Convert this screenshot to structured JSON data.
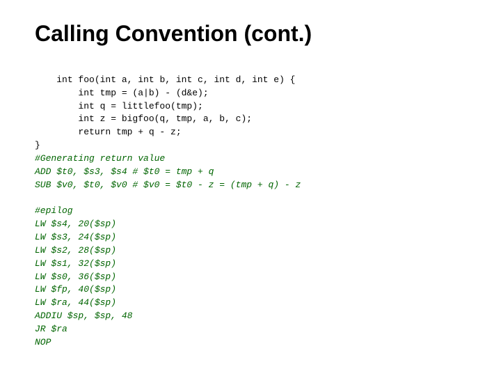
{
  "title": "Calling Convention (cont.)",
  "code": {
    "c_code_line1": "int foo(int a, int b, int c, int d, int e) {",
    "c_code_line2": "        int tmp = (a|b) - (d&e);",
    "c_code_line3": "        int q = littlefoo(tmp);",
    "c_code_line4": "        int z = bigfoo(q, tmp, a, b, c);",
    "c_code_line5": "        return tmp + q - z;",
    "c_code_line6": "}",
    "comment1": "#Generating return value",
    "asm_line1": "ADD $t0, $s3, $s4 # $t0 = tmp + q",
    "asm_line2": "SUB $v0, $t0, $v0 # $v0 = $t0 - z = (tmp + q) - z",
    "comment2": "#epilog",
    "epilog_line1": "LW $s4, 20($sp)",
    "epilog_line2": "LW $s3, 24($sp)",
    "epilog_line3": "LW $s2, 28($sp)",
    "epilog_line4": "LW $s1, 32($sp)",
    "epilog_line5": "LW $s0, 36($sp)",
    "epilog_line6": "LW $fp, 40($sp)",
    "epilog_line7": "LW $ra, 44($sp)",
    "epilog_line8": "ADDIU $sp, $sp, 48",
    "epilog_line9": "JR $ra",
    "epilog_line10": "NOP"
  }
}
